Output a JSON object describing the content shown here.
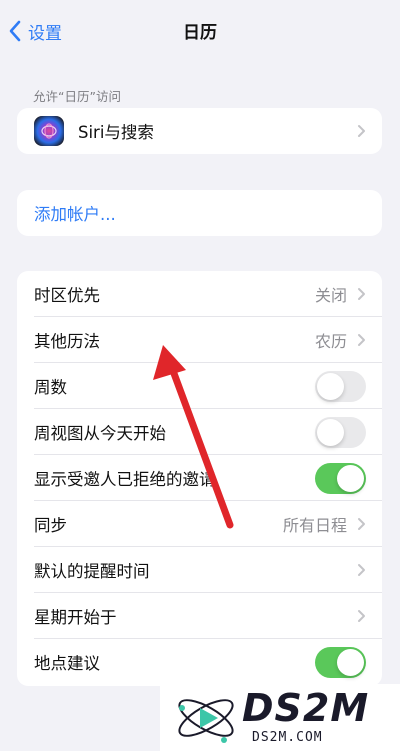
{
  "nav": {
    "back_label": "设置",
    "title": "日历"
  },
  "allow_section": {
    "header": "允许“日历”访问",
    "siri_label": "Siri与搜索"
  },
  "accounts": {
    "add_account_label": "添加帐户..."
  },
  "settings": {
    "timezone_override": {
      "label": "时区优先",
      "value": "关闭"
    },
    "alternate_calendars": {
      "label": "其他历法",
      "value": "农历"
    },
    "week_numbers": {
      "label": "周数",
      "on": false
    },
    "week_view_starts_today": {
      "label": "周视图从今天开始",
      "on": false
    },
    "show_declined_invites": {
      "label": "显示受邀人已拒绝的邀请",
      "on": true
    },
    "sync": {
      "label": "同步",
      "value": "所有日程"
    },
    "default_alert_times": {
      "label": "默认的提醒时间"
    },
    "start_week_on": {
      "label": "星期开始于"
    },
    "location_suggestions": {
      "label": "地点建议",
      "on": true
    }
  },
  "watermark": {
    "logo_text": "DS2M",
    "url_text": "DS2M.COM"
  },
  "colors": {
    "accent_blue": "#2f7cf6",
    "toggle_on": "#5ac85a",
    "toggle_off": "#e9e9eb",
    "annotation_arrow": "#e0262a",
    "background": "#f2f2f7"
  }
}
